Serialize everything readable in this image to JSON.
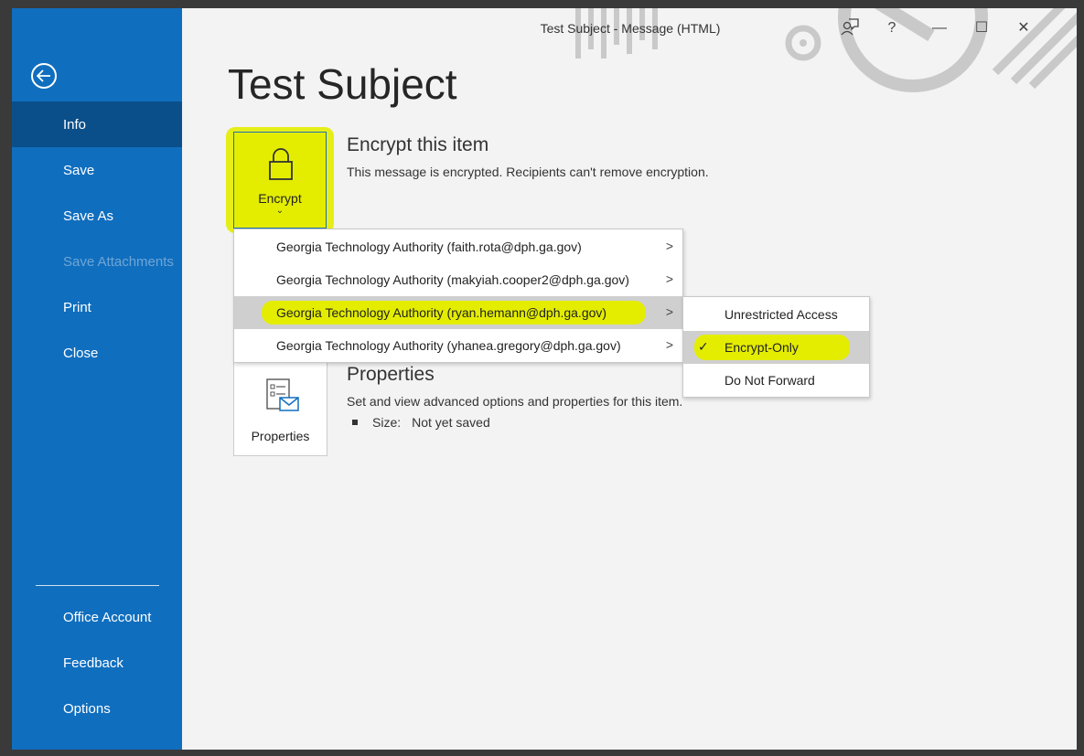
{
  "window": {
    "title": "Test Subject  -  Message (HTML)"
  },
  "titlebar_icons": [
    "coauthor-icon",
    "help-icon",
    "minimize-icon",
    "maximize-icon",
    "close-icon"
  ],
  "titlebar_glyphs": {
    "help": "?",
    "minimize": "—",
    "maximize": "☐",
    "close": "✕"
  },
  "sidebar": {
    "items": [
      {
        "label": "Info",
        "active": true,
        "enabled": true
      },
      {
        "label": "Save",
        "active": false,
        "enabled": true
      },
      {
        "label": "Save As",
        "active": false,
        "enabled": true
      },
      {
        "label": "Save Attachments",
        "active": false,
        "enabled": false
      },
      {
        "label": "Print",
        "active": false,
        "enabled": true
      },
      {
        "label": "Close",
        "active": false,
        "enabled": true
      }
    ],
    "bottom_items": [
      {
        "label": "Office Account"
      },
      {
        "label": "Feedback"
      },
      {
        "label": "Options"
      }
    ]
  },
  "main": {
    "page_title": "Test Subject",
    "encrypt": {
      "tile_label": "Encrypt",
      "heading": "Encrypt this item",
      "description": "This message is encrypted. Recipients can't remove encryption."
    },
    "properties": {
      "tile_label": "Properties",
      "heading": "Properties",
      "description": "Set and view advanced options and properties for this item.",
      "size_label": "Size:",
      "size_value": "Not yet saved"
    }
  },
  "menu": {
    "items": [
      {
        "label": "Georgia Technology Authority (faith.rota@dph.ga.gov)"
      },
      {
        "label": "Georgia Technology Authority (makyiah.cooper2@dph.ga.gov)"
      },
      {
        "label": "Georgia Technology Authority (ryan.hemann@dph.ga.gov)"
      },
      {
        "label": "Georgia Technology Authority (yhanea.gregory@dph.ga.gov)"
      }
    ],
    "hovered_index": 2
  },
  "submenu": {
    "items": [
      {
        "label": "Unrestricted Access",
        "checked": false
      },
      {
        "label": "Encrypt-Only",
        "checked": true
      },
      {
        "label": "Do Not Forward",
        "checked": false
      }
    ]
  },
  "colors": {
    "sidebar": "#106ebe",
    "sidebar_active": "#0a4f8a",
    "highlight": "#e4ed00"
  }
}
